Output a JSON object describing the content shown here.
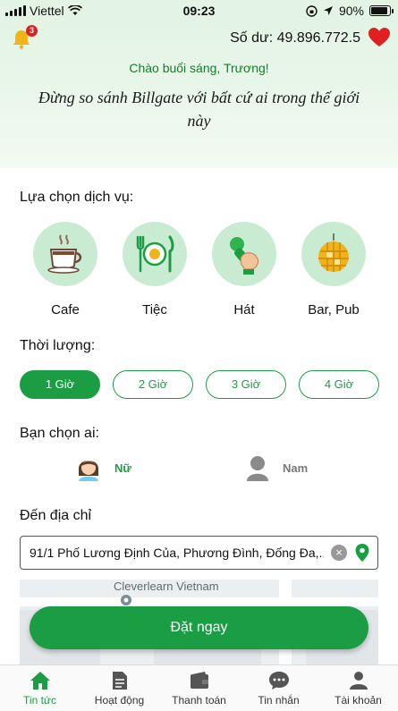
{
  "status": {
    "carrier": "Viettel",
    "time": "09:23",
    "battery": "90%"
  },
  "header": {
    "notification_count": "3",
    "balance_label": "Số dư: 49.896.772.5",
    "greeting": "Chào buổi sáng, Trương!",
    "quote": "Đừng so sánh Billgate với bất cứ ai trong thế giới này"
  },
  "services": {
    "title": "Lựa chọn dịch vụ:",
    "items": [
      {
        "label": "Cafe",
        "icon": "coffee-cup-icon"
      },
      {
        "label": "Tiệc",
        "icon": "dining-plate-icon"
      },
      {
        "label": "Hát",
        "icon": "microphone-icon"
      },
      {
        "label": "Bar, Pub",
        "icon": "disco-ball-icon"
      }
    ]
  },
  "duration": {
    "title": "Thời lượng:",
    "options": [
      "1 Giờ",
      "2 Giờ",
      "3 Giờ",
      "4 Giờ"
    ],
    "selected": "1 Giờ"
  },
  "partner": {
    "title": "Bạn chọn ai:",
    "female": "Nữ",
    "male": "Nam",
    "selected": "Nữ"
  },
  "address": {
    "title": "Đến địa chỉ",
    "value": "91/1 Phố Lương Định Của, Phương Đình, Đống Đa,..."
  },
  "map": {
    "poi": "Cleverlearn Vietnam"
  },
  "cta": {
    "label": "Đặt ngay"
  },
  "tabs": [
    {
      "label": "Tin tức",
      "icon": "home-icon",
      "active": true
    },
    {
      "label": "Hoạt động",
      "icon": "document-icon",
      "active": false
    },
    {
      "label": "Thanh toán",
      "icon": "wallet-icon",
      "active": false
    },
    {
      "label": "Tin nhắn",
      "icon": "chat-icon",
      "active": false
    },
    {
      "label": "Tài khoản",
      "icon": "user-icon",
      "active": false
    }
  ],
  "colors": {
    "primary": "#1b9e43",
    "header_bg": "#e3f4e4",
    "heart": "#e02020",
    "service_circle": "#c9ebd2"
  }
}
